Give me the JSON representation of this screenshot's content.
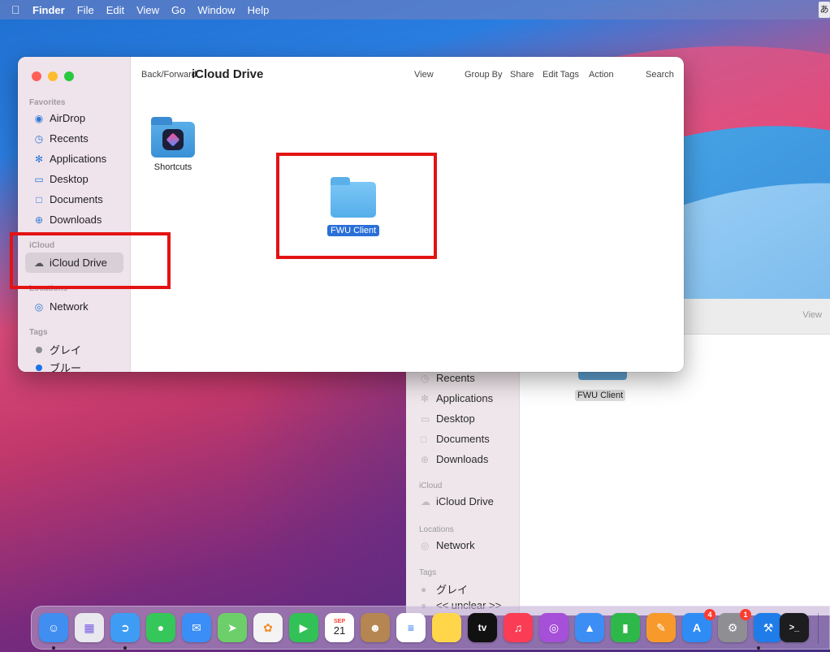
{
  "menubar": {
    "app": "Finder",
    "items": [
      "File",
      "Edit",
      "View",
      "Go",
      "Window",
      "Help"
    ],
    "input_indicator": "あ"
  },
  "window": {
    "toolbar": {
      "back_forward": "Back/Forward",
      "title": "iCloud Drive",
      "view": "View",
      "group_by": "Group By",
      "share": "Share",
      "edit_tags": "Edit Tags",
      "action": "Action",
      "search": "Search"
    },
    "sidebar": {
      "favorites_header": "Favorites",
      "favorites": [
        {
          "label": "AirDrop",
          "icon": "airdrop-icon"
        },
        {
          "label": "Recents",
          "icon": "clock-icon"
        },
        {
          "label": "Applications",
          "icon": "applications-icon"
        },
        {
          "label": "Desktop",
          "icon": "desktop-icon"
        },
        {
          "label": "Documents",
          "icon": "document-icon"
        },
        {
          "label": "Downloads",
          "icon": "download-icon"
        }
      ],
      "icloud_header": "iCloud",
      "icloud_drive": "iCloud Drive",
      "locations_header": "Locations",
      "network": "Network",
      "tags_header": "Tags",
      "tags": [
        {
          "label": "グレイ",
          "color": "#8e8e93"
        },
        {
          "label": "ブルー",
          "color": "#1a73e8"
        }
      ]
    },
    "items": [
      {
        "label": "Shortcuts",
        "icon": "shortcuts-folder-icon"
      },
      {
        "label": "FWU Client",
        "icon": "folder-icon"
      }
    ]
  },
  "background_window": {
    "view": "View",
    "sidebar": {
      "recents": "Recents",
      "applications": "Applications",
      "desktop": "Desktop",
      "documents": "Documents",
      "downloads": "Downloads",
      "icloud_header": "iCloud",
      "icloud_drive": "iCloud Drive",
      "locations_header": "Locations",
      "network": "Network",
      "tags_header": "Tags",
      "tag_gray": "グレイ",
      "tag_blue": "<< unclear >>"
    },
    "item": "FWU Client"
  },
  "dock": {
    "apps": [
      {
        "name": "finder-icon",
        "color": "#3f8ef0"
      },
      {
        "name": "launchpad-icon",
        "color": "#e8e8ee"
      },
      {
        "name": "safari-icon",
        "color": "#3e9cf5"
      },
      {
        "name": "messages-icon",
        "color": "#35c759"
      },
      {
        "name": "mail-icon",
        "color": "#3a8ef5"
      },
      {
        "name": "maps-icon",
        "color": "#6dcf6a"
      },
      {
        "name": "photos-icon",
        "color": "#f3f3f3"
      },
      {
        "name": "facetime-icon",
        "color": "#32c157"
      },
      {
        "name": "calendar-icon",
        "color": "#ffffff",
        "month": "SEP",
        "day": "21"
      },
      {
        "name": "contacts-icon",
        "color": "#b58552"
      },
      {
        "name": "reminders-icon",
        "color": "#ffffff"
      },
      {
        "name": "notes-icon",
        "color": "#ffd64a"
      },
      {
        "name": "appletv-icon",
        "color": "#111111",
        "text": "tv"
      },
      {
        "name": "music-icon",
        "color": "#fa3c55"
      },
      {
        "name": "podcasts-icon",
        "color": "#a64fd8"
      },
      {
        "name": "keynote-icon",
        "color": "#3c8ef5"
      },
      {
        "name": "numbers-icon",
        "color": "#2fb84a"
      },
      {
        "name": "pages-icon",
        "color": "#f79a2b"
      },
      {
        "name": "appstore-icon",
        "color": "#2f8cf5",
        "badge": "4"
      },
      {
        "name": "system-preferences-icon",
        "color": "#8e8e93",
        "badge": "1"
      },
      {
        "name": "xcode-icon",
        "color": "#1f7ce8"
      },
      {
        "name": "terminal-icon",
        "color": "#1d1d1f",
        "text": ">_"
      }
    ]
  }
}
